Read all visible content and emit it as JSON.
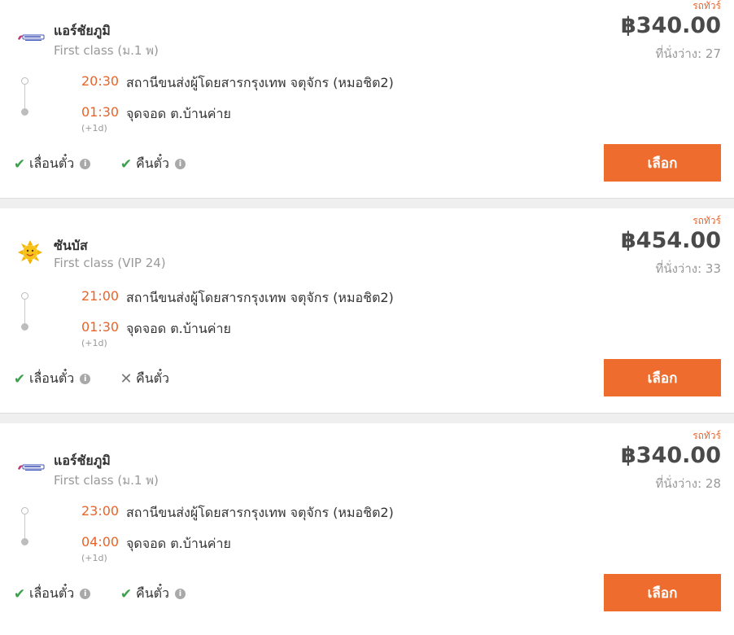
{
  "brand": {
    "accent": "#ee6c2d",
    "time_color": "#e8642a",
    "check_color": "#3aa14a"
  },
  "results": [
    {
      "tag": "รถทัวร์",
      "operator": "แอร์ชัยภูมิ",
      "logo_icon": "air-chaiyaphum-logo",
      "bus_class": "First class (ม.1 พ)",
      "price": "฿340.00",
      "seats": "ที่นั่งว่าง: 27",
      "departure": {
        "time": "20:30",
        "place": "สถานีขนส่งผู้โดยสารกรุงเทพ จตุจักร (หมอชิต2)"
      },
      "arrival": {
        "time": "01:30",
        "place": "จุดจอด ต.บ้านค่าย",
        "note": "(+1d)"
      },
      "policies": [
        {
          "label": "เลื่อนตั๋ว",
          "allowed": true,
          "icon": "check-icon"
        },
        {
          "label": "คืนตั๋ว",
          "allowed": true,
          "icon": "check-icon"
        }
      ],
      "button": "เลือก"
    },
    {
      "tag": "รถทัวร์",
      "operator": "ซันบัส",
      "logo_icon": "sun-logo",
      "bus_class": "First class (VIP 24)",
      "price": "฿454.00",
      "seats": "ที่นั่งว่าง: 33",
      "departure": {
        "time": "21:00",
        "place": "สถานีขนส่งผู้โดยสารกรุงเทพ จตุจักร (หมอชิต2)"
      },
      "arrival": {
        "time": "01:30",
        "place": "จุดจอด ต.บ้านค่าย",
        "note": "(+1d)"
      },
      "policies": [
        {
          "label": "เลื่อนตั๋ว",
          "allowed": true,
          "icon": "check-icon"
        },
        {
          "label": "คืนตั๋ว",
          "allowed": false,
          "icon": "cross-icon"
        }
      ],
      "button": "เลือก"
    },
    {
      "tag": "รถทัวร์",
      "operator": "แอร์ชัยภูมิ",
      "logo_icon": "air-chaiyaphum-logo",
      "bus_class": "First class (ม.1 พ)",
      "price": "฿340.00",
      "seats": "ที่นั่งว่าง: 28",
      "departure": {
        "time": "23:00",
        "place": "สถานีขนส่งผู้โดยสารกรุงเทพ จตุจักร (หมอชิต2)"
      },
      "arrival": {
        "time": "04:00",
        "place": "จุดจอด ต.บ้านค่าย",
        "note": "(+1d)"
      },
      "policies": [
        {
          "label": "เลื่อนตั๋ว",
          "allowed": true,
          "icon": "check-icon"
        },
        {
          "label": "คืนตั๋ว",
          "allowed": true,
          "icon": "check-icon"
        }
      ],
      "button": "เลือก"
    }
  ]
}
